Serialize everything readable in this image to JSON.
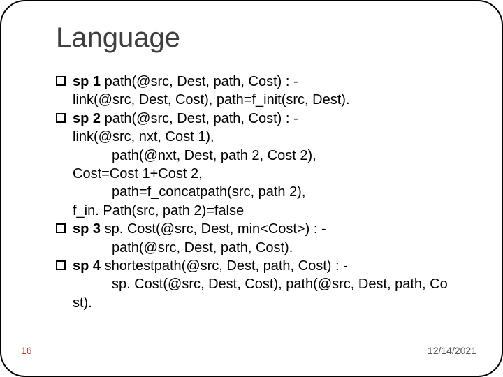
{
  "title": "Language",
  "rules": {
    "sp1": {
      "label": "sp 1",
      "head": " path(@src, Dest, path, Cost) : -",
      "body1": "link(@src, Dest, Cost),         path=f_init(src, Dest)."
    },
    "sp2": {
      "label": "sp 2",
      "head": "  path(@src, Dest, path, Cost) : -",
      "body1": "link(@src, nxt, Cost 1),",
      "body2": "path(@nxt, Dest, path 2, Cost 2),",
      "body3": "Cost=Cost 1+Cost 2,",
      "body4": "path=f_concatpath(src, path 2),",
      "body5": "f_in. Path(src, path 2)=false"
    },
    "sp3": {
      "label": "sp 3",
      "head": " sp. Cost(@src, Dest, min<Cost>) : -",
      "body1": "path(@src, Dest, path, Cost)."
    },
    "sp4": {
      "label": "sp 4",
      "head": "  shortestpath(@src, Dest, path, Cost) : -",
      "body1": "sp. Cost(@src, Dest, Cost), path(@src, Dest, path, Co",
      "body2": "st)."
    }
  },
  "page_number": "16",
  "date": "12/14/2021"
}
